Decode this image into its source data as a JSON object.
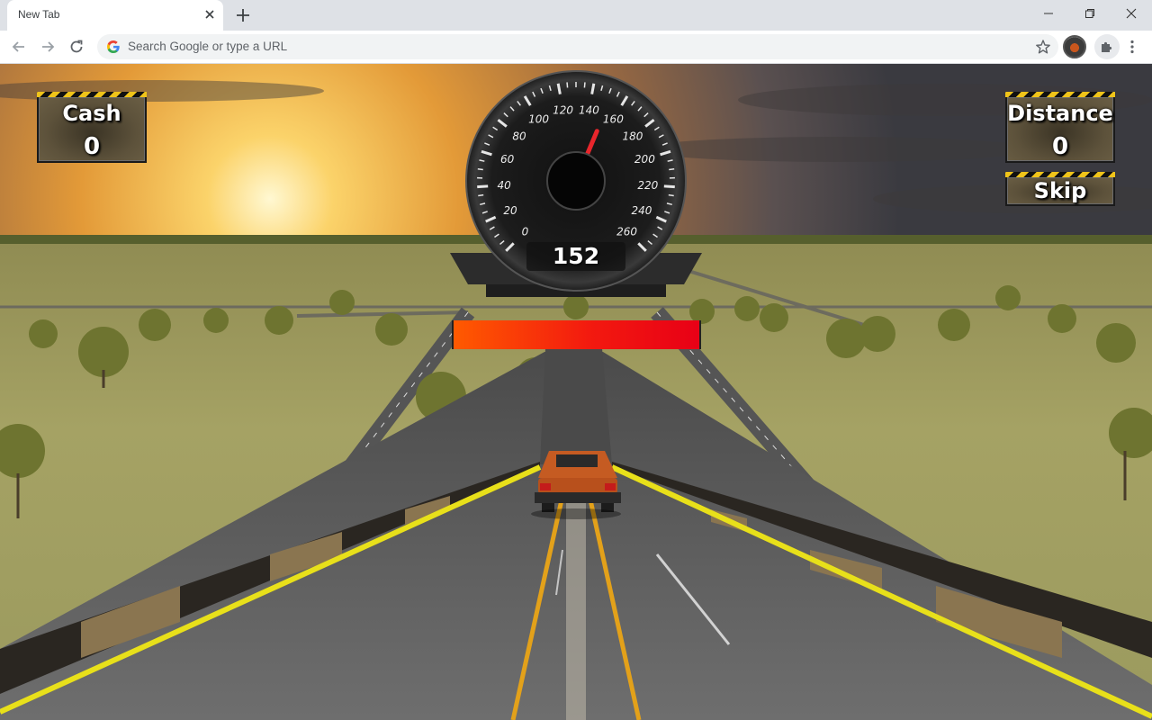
{
  "browser": {
    "tab_title": "New Tab",
    "omnibox_placeholder": "Search Google or type a URL",
    "icons": [
      "close-icon",
      "plus-icon",
      "minimize-icon",
      "maximize-icon",
      "window-close-icon",
      "back-arrow-icon",
      "forward-arrow-icon",
      "reload-icon",
      "google-g-icon",
      "star-icon",
      "puzzle-icon",
      "menu-dots-icon"
    ]
  },
  "hud": {
    "cash_label": "Cash",
    "cash_value": "0",
    "distance_label": "Distance",
    "distance_value": "0",
    "skip_label": "Skip",
    "speed_value": "152",
    "boost_level": 1.0,
    "speedometer": {
      "ticks": [
        "0",
        "20",
        "40",
        "60",
        "80",
        "100",
        "120",
        "140",
        "160",
        "180",
        "200",
        "220",
        "240",
        "260"
      ],
      "min": 0,
      "max": 260,
      "needle_value": 152
    }
  },
  "colors": {
    "boost_start": "#ff5a00",
    "boost_end": "#e80016",
    "hazard_yellow": "#f0c419",
    "needle": "#e8262c",
    "road_edge_yellow": "#e8e01a",
    "car_body": "#b8501c"
  }
}
